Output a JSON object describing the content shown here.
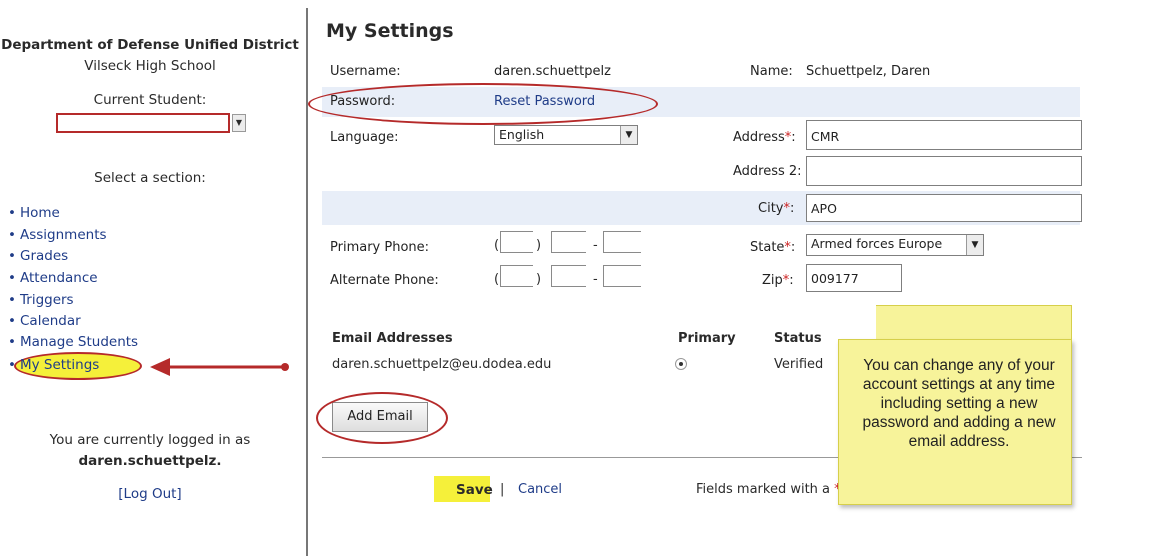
{
  "sidebar": {
    "district": "Department of Defense Unified District",
    "school": "Vilseck High School",
    "current_student_label": "Current Student:",
    "current_student_value": "",
    "select_section_label": "Select a section:",
    "nav_items": [
      {
        "label": "Home"
      },
      {
        "label": "Assignments"
      },
      {
        "label": "Grades"
      },
      {
        "label": "Attendance"
      },
      {
        "label": "Triggers"
      },
      {
        "label": "Calendar"
      },
      {
        "label": "Manage Students"
      },
      {
        "label": "My Settings"
      }
    ],
    "logged_in_text": "You are currently logged in as",
    "username": "daren.schuettpelz.",
    "logout_label": "[Log Out]"
  },
  "settings": {
    "title": "My Settings",
    "username_label": "Username:",
    "username_value": "daren.schuettpelz",
    "name_label": "Name:",
    "name_value": "Schuettpelz, Daren",
    "password_label": "Password:",
    "reset_password_link": "Reset Password",
    "language_label": "Language:",
    "language_value": "English",
    "address_label": "Address",
    "address_value": "CMR",
    "address2_label": "Address 2:",
    "address2_value": "",
    "city_label": "City",
    "city_value": "APO",
    "state_label": "State",
    "state_value": "Armed forces Europe",
    "zip_label": "Zip",
    "zip_value": "009177",
    "primary_phone_label": "Primary Phone:",
    "alternate_phone_label": "Alternate Phone:",
    "required_mark": "*",
    "colon": ":"
  },
  "email": {
    "header_addresses": "Email Addresses",
    "header_primary": "Primary",
    "header_status": "Status",
    "rows": [
      {
        "address": "daren.schuettpelz@eu.dodea.edu",
        "status": "Verified"
      }
    ],
    "add_button": "Add Email"
  },
  "footer": {
    "save": "Save",
    "separator": "|",
    "cancel": "Cancel",
    "fields_marked": "Fields marked with a"
  },
  "callout": {
    "text": "You can change any of your account settings at any time including setting a new password and adding a new email address."
  },
  "colors": {
    "accent_red": "#b52a2a",
    "highlight_yellow": "#f5f03a",
    "link_blue": "#1f3c88",
    "band_blue": "#e8eef8"
  }
}
